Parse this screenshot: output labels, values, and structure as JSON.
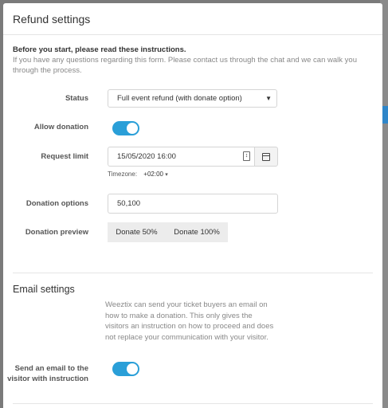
{
  "modal": {
    "title": "Refund settings",
    "intro_lead": "Before you start, please read ",
    "intro_link": "these instructions",
    "intro_sub": "If you have any questions regarding this form. Please contact us through the chat and we can walk you through the process."
  },
  "form": {
    "status_label": "Status",
    "status_value": "Full event refund (with donate option)",
    "allow_donation_label": "Allow donation",
    "allow_donation_on": true,
    "request_limit_label": "Request limit",
    "request_limit_value": "15/05/2020 16:00",
    "timezone_label": "Timezone:",
    "timezone_value": "+02:00",
    "donation_options_label": "Donation options",
    "donation_options_value": "50,100",
    "donation_preview_label": "Donation preview",
    "preview_buttons": [
      "Donate 50%",
      "Donate 100%"
    ]
  },
  "email": {
    "section_title": "Email settings",
    "description": "Weeztix can send your ticket buyers an email on how to make a donation. This only gives the visitors an instruction on how to proceed and does not replace your communication with your visitor.",
    "send_label": "Send an email to the visitor with instruction",
    "send_on": true
  },
  "colors": {
    "toggle_on": "#2a9fd8",
    "overlay": "#7a7a7a"
  }
}
